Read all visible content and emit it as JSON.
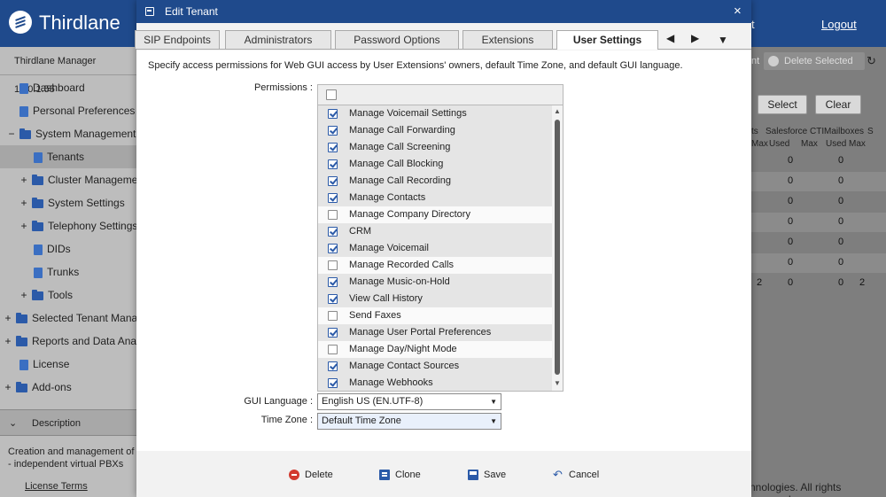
{
  "app": {
    "brand": "Thirdlane",
    "top_right_fragment": "t",
    "logout": "Logout",
    "version": "Thirdlane Manager 10.0.1.55"
  },
  "sidebar": {
    "items": [
      {
        "label": "Dashboard",
        "icon": "doc-icon"
      },
      {
        "label": "Personal Preferences",
        "icon": "doc-icon"
      },
      {
        "label": "System Management",
        "icon": "folder-icon",
        "expander": "−"
      },
      {
        "label": "Tenants",
        "icon": "doc-icon"
      },
      {
        "label": "Cluster Management",
        "icon": "folder-icon",
        "expander": "+"
      },
      {
        "label": "System Settings",
        "icon": "folder-icon",
        "expander": "+"
      },
      {
        "label": "Telephony Settings",
        "icon": "folder-icon",
        "expander": "+"
      },
      {
        "label": "DIDs",
        "icon": "doc-icon"
      },
      {
        "label": "Trunks",
        "icon": "doc-icon"
      },
      {
        "label": "Tools",
        "icon": "folder-icon",
        "expander": "+"
      },
      {
        "label": "Selected Tenant Management",
        "icon": "folder-icon",
        "expander": "+"
      },
      {
        "label": "Reports and Data Analysis",
        "icon": "folder-icon",
        "expander": "+"
      },
      {
        "label": "License",
        "icon": "doc-icon"
      },
      {
        "label": "Add-ons",
        "icon": "folder-icon",
        "expander": "+"
      }
    ],
    "description_label": "Description",
    "description_text": "Creation and management of - independent virtual PBXs",
    "license_terms": "License Terms"
  },
  "right_panel": {
    "toolbar_fragment": "nt",
    "delete_selected": "Delete Selected",
    "select": "Select",
    "clear": "Clear",
    "headers": {
      "col1": "ts",
      "salesforce": "Salesforce CTI",
      "mailboxes": "Mailboxes",
      "s": "S",
      "max1": "Max",
      "used1": "Used",
      "max2": "Max",
      "used2": "Used",
      "max3": "Max"
    },
    "rows": [
      {
        "a": "",
        "b": "0",
        "c": "0",
        "d": ""
      },
      {
        "a": "",
        "b": "0",
        "c": "0",
        "d": ""
      },
      {
        "a": "",
        "b": "0",
        "c": "0",
        "d": ""
      },
      {
        "a": "",
        "b": "0",
        "c": "0",
        "d": ""
      },
      {
        "a": "",
        "b": "0",
        "c": "0",
        "d": ""
      },
      {
        "a": "",
        "b": "0",
        "c": "0",
        "d": ""
      },
      {
        "a": "2",
        "b": "0",
        "c": "0",
        "d": "2"
      }
    ],
    "copyright": "nnologies. All rights reserved."
  },
  "modal": {
    "title": "Edit Tenant",
    "close": "×",
    "tabs": [
      {
        "label": "SIP Endpoints",
        "active": false
      },
      {
        "label": "Administrators",
        "active": false
      },
      {
        "label": "Password Options",
        "active": false
      },
      {
        "label": "Extensions",
        "active": false
      },
      {
        "label": "User Settings",
        "active": true
      }
    ],
    "tab_prev": "◀",
    "tab_next": "▶",
    "tab_menu": "▼",
    "description": "Specify access permissions for Web GUI access by User Extensions' owners, default Time Zone, and default GUI language.",
    "permissions_label": "Permissions :",
    "permissions": [
      {
        "label": "Manage Voicemail Settings",
        "checked": true
      },
      {
        "label": "Manage Call Forwarding",
        "checked": true
      },
      {
        "label": "Manage Call Screening",
        "checked": true
      },
      {
        "label": "Manage Call Blocking",
        "checked": true
      },
      {
        "label": "Manage Call Recording",
        "checked": true
      },
      {
        "label": "Manage Contacts",
        "checked": true
      },
      {
        "label": "Manage Company Directory",
        "checked": false
      },
      {
        "label": "CRM",
        "checked": true
      },
      {
        "label": "Manage Voicemail",
        "checked": true
      },
      {
        "label": "Manage Recorded Calls",
        "checked": false
      },
      {
        "label": "Manage Music-on-Hold",
        "checked": true
      },
      {
        "label": "View Call History",
        "checked": true
      },
      {
        "label": "Send Faxes",
        "checked": false
      },
      {
        "label": "Manage User Portal Preferences",
        "checked": true
      },
      {
        "label": "Manage Day/Night Mode",
        "checked": false
      },
      {
        "label": "Manage Contact Sources",
        "checked": true
      },
      {
        "label": "Manage Webhooks",
        "checked": true
      }
    ],
    "gui_language_label": "GUI Language :",
    "gui_language_value": "English US (EN.UTF-8)",
    "time_zone_label": "Time Zone :",
    "time_zone_value": "Default Time Zone",
    "footer": {
      "delete": "Delete",
      "clone": "Clone",
      "save": "Save",
      "cancel": "Cancel"
    }
  }
}
